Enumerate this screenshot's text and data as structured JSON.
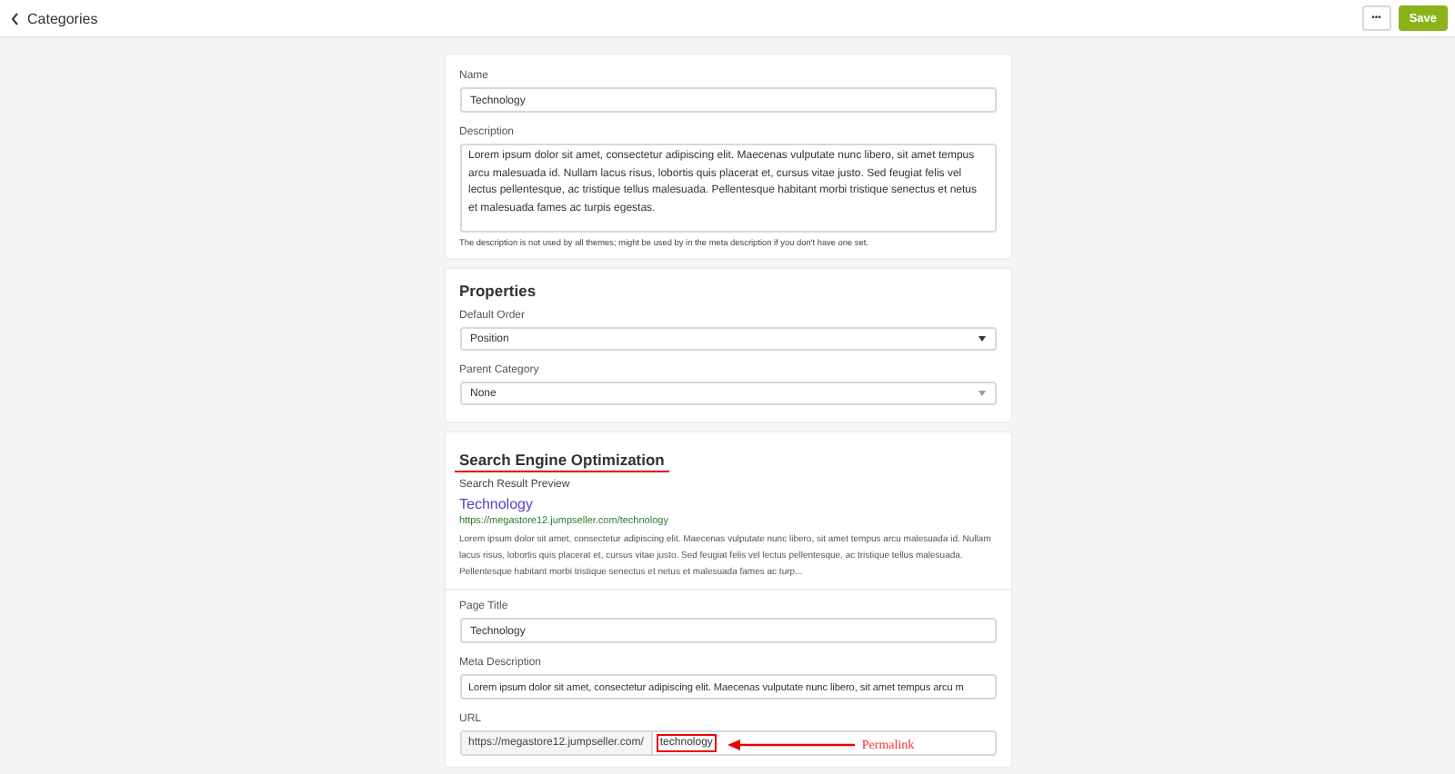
{
  "topbar": {
    "back_label": "Categories",
    "more_label": "•••",
    "save_label": "Save"
  },
  "general": {
    "name": {
      "label": "Name",
      "value": "Technology"
    },
    "description": {
      "label": "Description",
      "value": "Lorem ipsum dolor sit amet, consectetur adipiscing elit. Maecenas vulputate nunc libero, sit amet tempus arcu malesuada id. Nullam lacus risus, lobortis quis placerat et, cursus vitae justo. Sed feugiat felis vel lectus pellentesque, ac tristique tellus malesuada. Pellentesque habitant morbi tristique senectus et netus et malesuada fames ac turpis egestas."
    },
    "help": "The description is not used by all themes; might be used by in the meta description if you don't have one set."
  },
  "properties": {
    "title": "Properties",
    "default_order": {
      "label": "Default Order",
      "value": "Position"
    },
    "parent_category": {
      "label": "Parent Category",
      "value": "None"
    }
  },
  "seo": {
    "title": "Search Engine Optimization",
    "preview_label": "Search Result Preview",
    "preview": {
      "title": "Technology",
      "url": "https://megastore12.jumpseller.com/technology",
      "description": "Lorem ipsum dolor sit amet, consectetur adipiscing elit. Maecenas vulputate nunc libero, sit amet tempus arcu malesuada id. Nullam lacus risus, lobortis quis placerat et, cursus vitae justo. Sed feugiat felis vel lectus pellentesque, ac tristique tellus malesuada. Pellentesque habitant morbi tristique senectus et netus et malesuada fames ac turp..."
    },
    "page_title": {
      "label": "Page Title",
      "value": "Technology"
    },
    "meta_description": {
      "label": "Meta Description",
      "value": "Lorem ipsum dolor sit amet, consectetur adipiscing elit. Maecenas vulputate nunc libero, sit amet tempus arcu m"
    },
    "url": {
      "label": "URL",
      "prefix": "https://megastore12.jumpseller.com/",
      "value": "technology"
    }
  },
  "annotations": [
    {
      "kind": "underline"
    },
    {
      "kind": "box"
    },
    {
      "kind": "arrow",
      "label": "Permalink"
    }
  ]
}
